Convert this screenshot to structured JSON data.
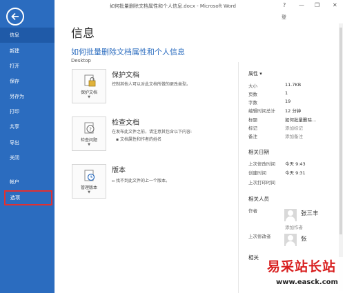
{
  "window": {
    "title": "如何批量删除文档属性和个人信息.docx - Microsoft Word",
    "help": "?",
    "minimize": "—",
    "restore": "❐",
    "close": "✕",
    "user": "登"
  },
  "sidebar": {
    "items": [
      {
        "label": "信息"
      },
      {
        "label": "新建"
      },
      {
        "label": "打开"
      },
      {
        "label": "保存"
      },
      {
        "label": "另存为"
      },
      {
        "label": "打印"
      },
      {
        "label": "共享"
      },
      {
        "label": "导出"
      },
      {
        "label": "关闭"
      },
      {
        "label": "帐户"
      },
      {
        "label": "选项"
      }
    ]
  },
  "main": {
    "page_title": "信息",
    "doc_title": "如何批量删除文档属性和个人信息",
    "doc_path": "Desktop",
    "protect": {
      "button": "保护文档",
      "title": "保护文档",
      "desc": "控制其他人可以对此文档所做的更改类型。"
    },
    "inspect": {
      "button": "检查问题",
      "title": "检查文档",
      "desc": "在发布此文件之前，请注意其包含以下内容:",
      "bullet": "文档属性和作者的姓名"
    },
    "versions": {
      "button": "管理版本",
      "title": "版本",
      "desc": "找不到此文件的上一个版本。"
    }
  },
  "properties": {
    "header": "属性 ▾",
    "rows": [
      {
        "key": "大小",
        "value": "11.7KB"
      },
      {
        "key": "页数",
        "value": "1"
      },
      {
        "key": "字数",
        "value": "19"
      },
      {
        "key": "编辑时间总计",
        "value": "12 分钟"
      },
      {
        "key": "标题",
        "value": "如何批量删除..."
      },
      {
        "key": "标记",
        "value": "添加标记"
      },
      {
        "key": "备注",
        "value": "添加备注"
      }
    ],
    "dates_header": "相关日期",
    "dates": [
      {
        "key": "上次修改时间",
        "value": "今天 9:43"
      },
      {
        "key": "创建时间",
        "value": "今天 9:31"
      },
      {
        "key": "上次打印时间",
        "value": ""
      }
    ],
    "people_header": "相关人员",
    "author_label": "作者",
    "author_name": "张三丰",
    "add_author": "添加作者",
    "modifier_label": "上次修改者",
    "modifier_name": "张",
    "docs_header": "相关"
  },
  "watermark": {
    "main": "易采站长站",
    "url": "www.easck.com"
  }
}
